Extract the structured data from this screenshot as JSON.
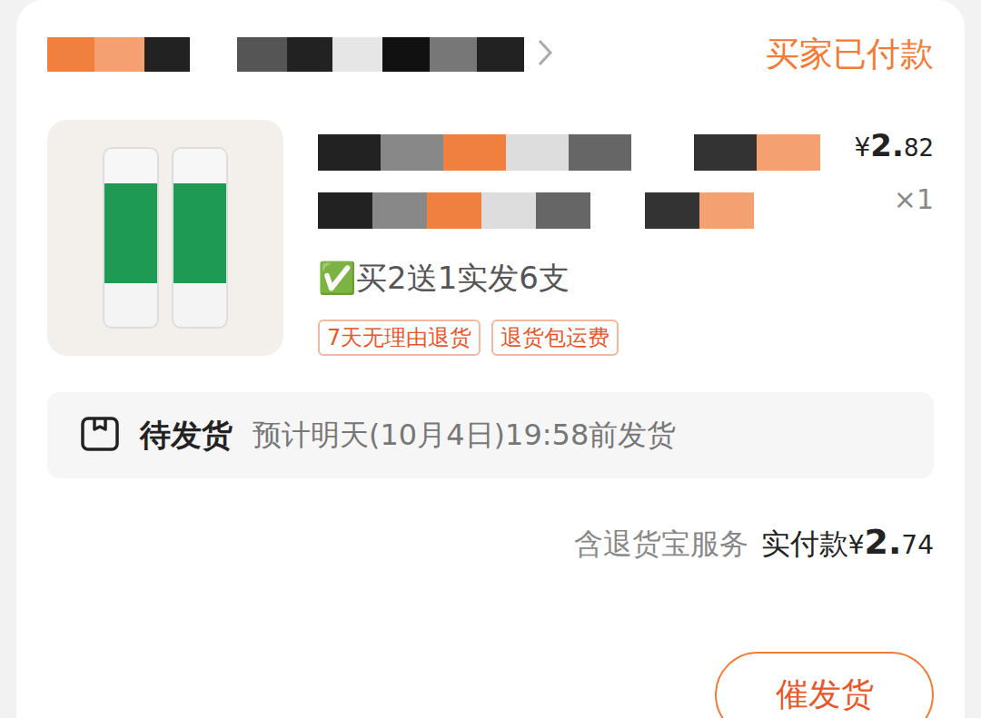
{
  "order_status": "买家已付款",
  "product": {
    "price": {
      "currency": "¥",
      "integer": "2.",
      "decimal": "82"
    },
    "quantity": "×1",
    "spec": "✅买2送1实发6支",
    "tags": [
      "7天无理由退货",
      "退货包运费"
    ]
  },
  "shipping": {
    "status": "待发货",
    "eta": "预计明天(10月4日)19:58前发货"
  },
  "total": {
    "service": "含退货宝服务",
    "label": "实付款",
    "currency": "¥",
    "integer": "2.",
    "decimal": "74"
  },
  "buttons": [
    "催发货"
  ]
}
